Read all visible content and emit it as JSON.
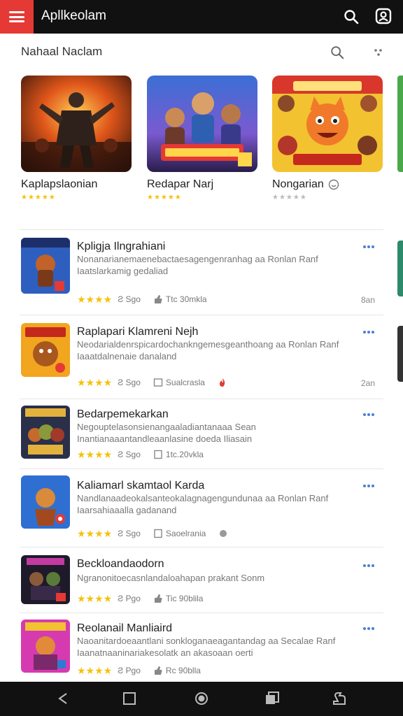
{
  "app": {
    "title": "Apllkeolam"
  },
  "section": {
    "title": "Nahaal Naclam"
  },
  "featured": [
    {
      "name": "Kaplapslaonian",
      "stars": "★★★★★"
    },
    {
      "name": "Redapar Narj",
      "stars": "★★★★★"
    },
    {
      "name": "Nongarian",
      "stars": "★★★★★"
    }
  ],
  "list": [
    {
      "title": "Kpligja Ilngrahiani",
      "desc1": "Nonanarianemaenebactaesagengenranhag aa Ronlan Ranf",
      "desc2": "Iaatslarkamig gedaliad",
      "stars": "★★★★",
      "meta1": "Ƨ Sgo",
      "meta2": "Ttc 30mkla",
      "right": "8an"
    },
    {
      "title": "Raplapari Klamreni Nejh",
      "desc1": "Neodarialdenrspicardochankngemesgeanthoang aa Ronlan Ranf",
      "desc2": "Iaaatdalnenaie danaland",
      "stars": "★★★★",
      "meta1": "Ƨ Sgo",
      "meta2": "Sualcrasla",
      "right": "2an"
    },
    {
      "title": "Bedarpemekarkan",
      "desc1": "Negouptelasonsienangaaladiantanaaa Sean",
      "desc2": "Inantianaaantandleaanlasine doeda Iliasain",
      "stars": "★★★★",
      "meta1": "Ƨ Sgo",
      "meta2": "1tc.20vkla",
      "right": ""
    },
    {
      "title": "Kaliamarl skamtaol Karda",
      "desc1": "Nandlanaadeokalsanteokalagnagengundunaa aa Ronlan Ranf",
      "desc2": "Iaarsahiaaalla gadanand",
      "stars": "★★★★",
      "meta1": "Ƨ Sgo",
      "meta2": "Saoelrania",
      "right": ""
    },
    {
      "title": "Beckloandaodorn",
      "desc1": "Ngranonitoecasnlandaloahapan prakant Sonm",
      "desc2": "",
      "stars": "★★★★",
      "meta1": "Ƨ Pgo",
      "meta2": "Tic 90blila",
      "right": ""
    },
    {
      "title": "Reolanail Manliaird",
      "desc1": "Naoanitardoeaantlani sonkloganaeagantandag aa Secalae Ranf",
      "desc2": "Iaanatnaaninariakesolatk an akasoaan oerti",
      "stars": "★★★★",
      "meta1": "Ƨ Pgo",
      "meta2": "Rc 90blla",
      "right": ""
    }
  ],
  "icons": {
    "menu": "menu-icon",
    "search": "search-icon",
    "profile": "profile-icon",
    "more": "more-icon",
    "back": "back-icon",
    "home": "home-icon",
    "recents": "recents-icon"
  },
  "colors": {
    "accent": "#e53935",
    "star": "#f4c20d",
    "more": "#4a7fd6"
  }
}
